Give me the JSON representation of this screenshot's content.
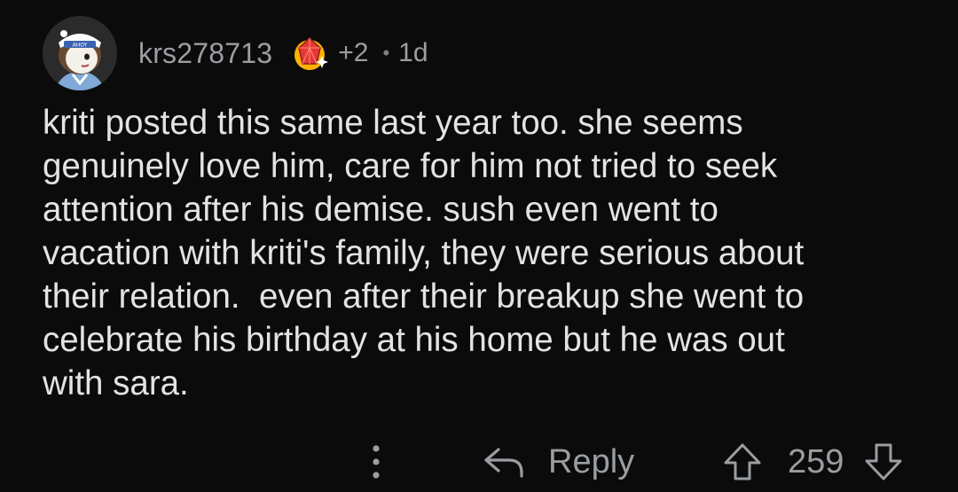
{
  "comment": {
    "username": "krs278713",
    "award": {
      "icon": "ruby-award-icon",
      "count": "+2"
    },
    "separator": "•",
    "age": "1d",
    "avatar_badge_text": "AHOY",
    "body": "kriti posted this same last year too. she seems\ngenuinely love him, care for him not tried to seek\nattention after his demise. sush even went to\nvacation with kriti's family, they were serious about\ntheir relation.  even after their breakup she went to\ncelebrate his birthday at his home but he was out\nwith sara."
  },
  "actions": {
    "more_icon": "more-vertical-icon",
    "reply_icon": "reply-arrow-icon",
    "reply_label": "Reply",
    "upvote_icon": "upvote-arrow-icon",
    "score": "259",
    "downvote_icon": "downvote-arrow-icon"
  },
  "colors": {
    "background": "#0b0b0b",
    "text": "#e1e3e5",
    "muted": "#9a9ea2"
  }
}
